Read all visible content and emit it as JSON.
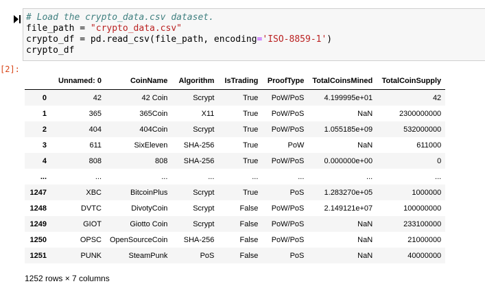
{
  "cell": {
    "prompt": "[2]:",
    "code_line1": "# Load the crypto_data.csv dataset.",
    "code_line2_a": "file_path = ",
    "code_line2_b": "\"crypto_data.csv\"",
    "code_line3_a": "crypto_df = pd.read_csv(file_path, encoding",
    "code_line3_op": "=",
    "code_line3_b": "'ISO-8859-1'",
    "code_line3_c": ")",
    "code_line4": "crypto_df"
  },
  "table": {
    "headers": [
      "",
      "Unnamed: 0",
      "CoinName",
      "Algorithm",
      "IsTrading",
      "ProofType",
      "TotalCoinsMined",
      "TotalCoinSupply"
    ],
    "rows": [
      [
        "0",
        "42",
        "42 Coin",
        "Scrypt",
        "True",
        "PoW/PoS",
        "4.199995e+01",
        "42"
      ],
      [
        "1",
        "365",
        "365Coin",
        "X11",
        "True",
        "PoW/PoS",
        "NaN",
        "2300000000"
      ],
      [
        "2",
        "404",
        "404Coin",
        "Scrypt",
        "True",
        "PoW/PoS",
        "1.055185e+09",
        "532000000"
      ],
      [
        "3",
        "611",
        "SixEleven",
        "SHA-256",
        "True",
        "PoW",
        "NaN",
        "611000"
      ],
      [
        "4",
        "808",
        "808",
        "SHA-256",
        "True",
        "PoW/PoS",
        "0.000000e+00",
        "0"
      ],
      [
        "...",
        "...",
        "...",
        "...",
        "...",
        "...",
        "...",
        "..."
      ],
      [
        "1247",
        "XBC",
        "BitcoinPlus",
        "Scrypt",
        "True",
        "PoS",
        "1.283270e+05",
        "1000000"
      ],
      [
        "1248",
        "DVTC",
        "DivotyCoin",
        "Scrypt",
        "False",
        "PoW/PoS",
        "2.149121e+07",
        "100000000"
      ],
      [
        "1249",
        "GIOT",
        "Giotto Coin",
        "Scrypt",
        "False",
        "PoW/PoS",
        "NaN",
        "233100000"
      ],
      [
        "1250",
        "OPSC",
        "OpenSourceCoin",
        "SHA-256",
        "False",
        "PoW/PoS",
        "NaN",
        "21000000"
      ],
      [
        "1251",
        "PUNK",
        "SteamPunk",
        "PoS",
        "False",
        "PoS",
        "NaN",
        "40000000"
      ]
    ]
  },
  "footer": "1252 rows × 7 columns"
}
